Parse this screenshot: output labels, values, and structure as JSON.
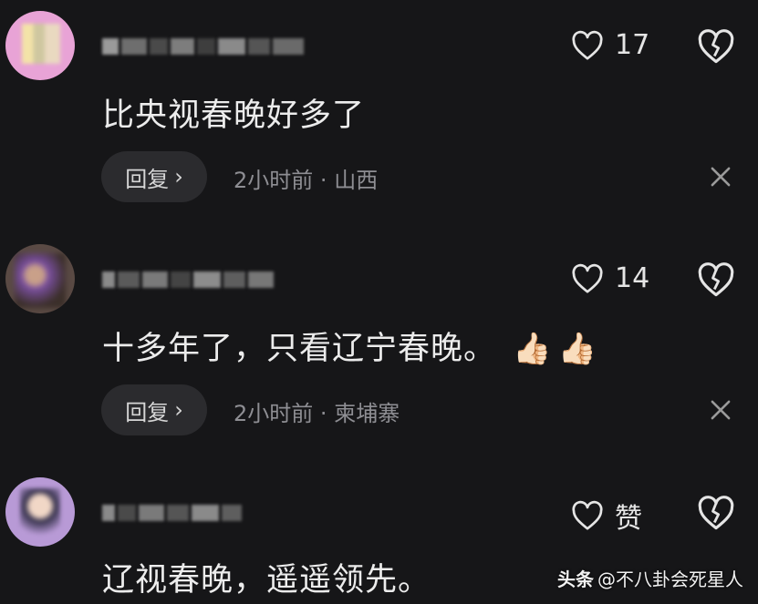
{
  "comments": [
    {
      "text": "比央视春晚好多了",
      "likes": "17",
      "reply_label": "回复",
      "time": "2小时前",
      "separator": "·",
      "location": "山西"
    },
    {
      "text": "十多年了，只看辽宁春晚。",
      "likes": "14",
      "reply_label": "回复",
      "time": "2小时前",
      "separator": "·",
      "location": "柬埔寨"
    },
    {
      "text": "辽视春晚，遥遥领先。",
      "likes": "赞"
    }
  ],
  "watermark": {
    "brand": "头条",
    "account": "@不八卦会死星人"
  },
  "icons": {
    "like": "heart-outline-icon",
    "dislike": "broken-heart-icon",
    "close": "close-icon",
    "reply_chevron": "chevron-right-icon",
    "thumbs": "thumbs-up-emoji"
  },
  "colors": {
    "background": "#161618",
    "text": "#ececec",
    "meta": "#8e8e93",
    "reply_pill": "#2b2b2e"
  }
}
